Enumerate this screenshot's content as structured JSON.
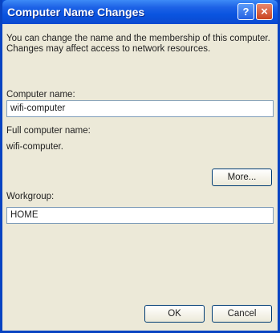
{
  "window": {
    "title": "Computer Name Changes",
    "help_glyph": "?",
    "close_glyph": "×"
  },
  "intro_text": "You can change the name and the membership of this computer. Changes may affect access to network resources.",
  "computer_name": {
    "label": "Computer name:",
    "value": "wifi-computer"
  },
  "full_name": {
    "label": "Full computer name:",
    "value": "wifi-computer."
  },
  "more_button": "More...",
  "workgroup": {
    "label": "Workgroup:",
    "value": "HOME"
  },
  "ok_button": "OK",
  "cancel_button": "Cancel",
  "colors": {
    "titlebar": "#0a54e0",
    "client": "#ece9d8",
    "close": "#c9431f"
  },
  "icons": [
    "help-icon",
    "close-icon"
  ]
}
